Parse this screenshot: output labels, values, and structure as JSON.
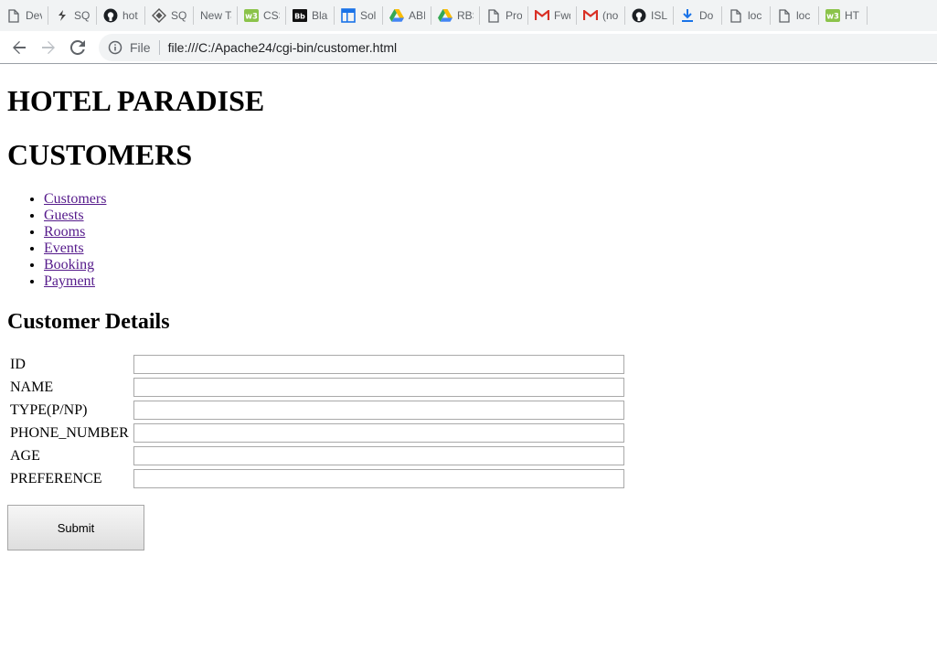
{
  "browser": {
    "bookmarks": [
      {
        "label": "Dev",
        "icon": "page-icon"
      },
      {
        "label": "SQL",
        "icon": "sql-icon"
      },
      {
        "label": "hot",
        "icon": "github-icon"
      },
      {
        "label": "SQL",
        "icon": "diamond-icon"
      },
      {
        "label": "New Tab",
        "icon": "none"
      },
      {
        "label": "CSS",
        "icon": "w3-icon"
      },
      {
        "label": "Bla",
        "icon": "bb-icon"
      },
      {
        "label": "Sol",
        "icon": "layout-icon"
      },
      {
        "label": "ABI",
        "icon": "drive-icon"
      },
      {
        "label": "RBS",
        "icon": "drive-icon"
      },
      {
        "label": "Pro",
        "icon": "page-icon"
      },
      {
        "label": "Fwd",
        "icon": "gmail-icon"
      },
      {
        "label": "(no",
        "icon": "gmail-icon"
      },
      {
        "label": "ISL",
        "icon": "github-icon"
      },
      {
        "label": "Do",
        "icon": "download-icon"
      },
      {
        "label": "loc",
        "icon": "page-icon"
      },
      {
        "label": "loc",
        "icon": "page-icon"
      },
      {
        "label": "HT",
        "icon": "w3-icon"
      }
    ],
    "address": {
      "scheme_label": "File",
      "url": "file:///C:/Apache24/cgi-bin/customer.html"
    },
    "colors": {
      "chrome_bg": "#f1f3f4",
      "link_visited": "#551a8b"
    }
  },
  "page": {
    "title": "HOTEL PARADISE",
    "section_title": "CUSTOMERS",
    "nav": [
      {
        "label": "Customers"
      },
      {
        "label": "Guests"
      },
      {
        "label": "Rooms"
      },
      {
        "label": "Events"
      },
      {
        "label": "Booking"
      },
      {
        "label": "Payment"
      }
    ],
    "form_title": "Customer Details",
    "fields": [
      {
        "label": "ID",
        "value": ""
      },
      {
        "label": "NAME",
        "value": ""
      },
      {
        "label": "TYPE(P/NP)",
        "value": ""
      },
      {
        "label": "PHONE_NUMBER",
        "value": ""
      },
      {
        "label": "AGE",
        "value": ""
      },
      {
        "label": "PREFERENCE",
        "value": ""
      }
    ],
    "submit_label": "Submit"
  }
}
